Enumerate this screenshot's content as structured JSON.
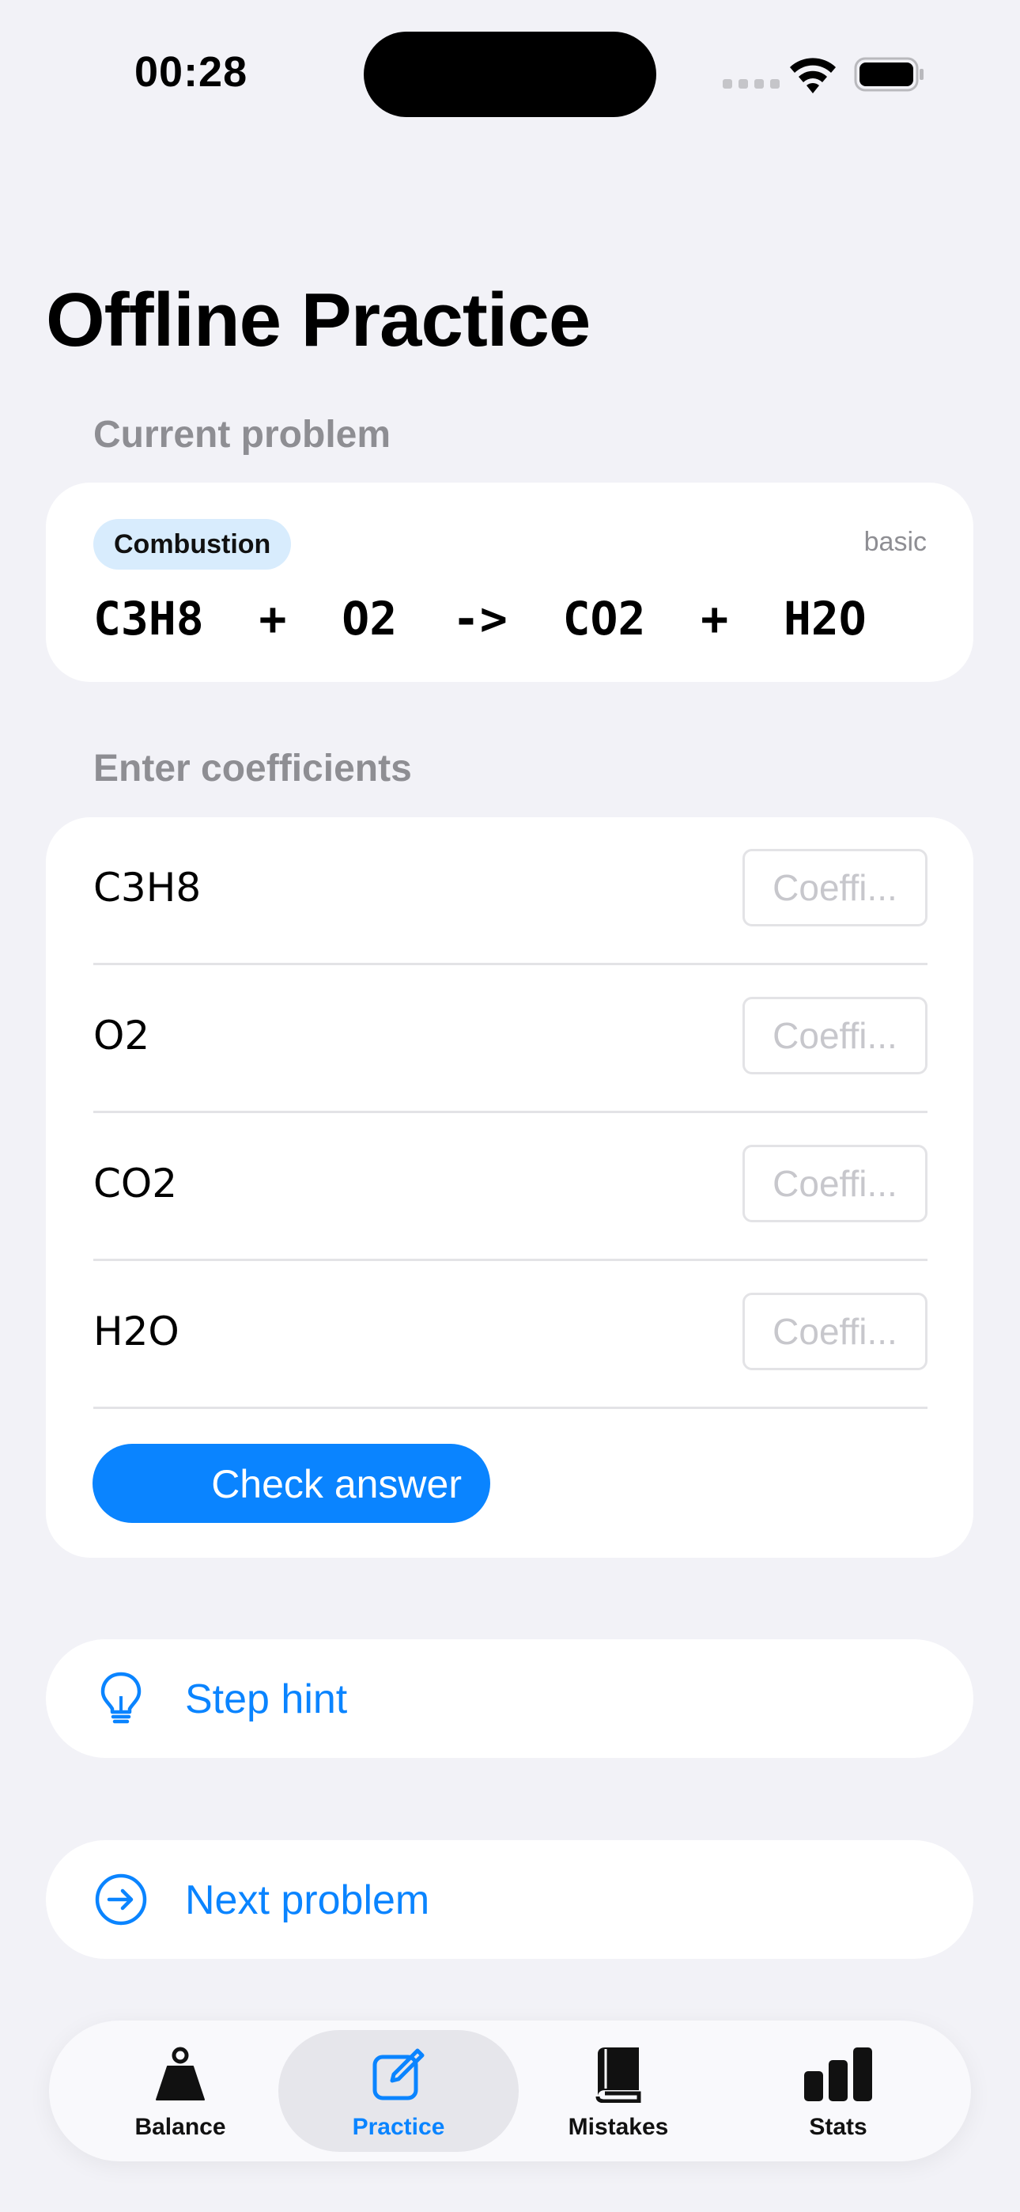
{
  "status_bar": {
    "time": "00:28"
  },
  "page_title": "Offline Practice",
  "current_problem": {
    "header": "Current problem",
    "category": "Combustion",
    "level": "basic",
    "equation": "C3H8 + O2 -> CO2 + H2O"
  },
  "coefficients": {
    "header": "Enter coefficients",
    "rows": [
      {
        "species": "C3H8",
        "placeholder": "Coeffi...",
        "value": ""
      },
      {
        "species": "O2",
        "placeholder": "Coeffi...",
        "value": ""
      },
      {
        "species": "CO2",
        "placeholder": "Coeffi...",
        "value": ""
      },
      {
        "species": "H2O",
        "placeholder": "Coeffi...",
        "value": ""
      }
    ],
    "check_label": "Check answer"
  },
  "actions": {
    "hint_label": "Step hint",
    "next_label": "Next problem"
  },
  "tabs": [
    {
      "label": "Balance",
      "icon": "scale-weight-icon",
      "active": false
    },
    {
      "label": "Practice",
      "icon": "square-pencil-icon",
      "active": true
    },
    {
      "label": "Mistakes",
      "icon": "book-icon",
      "active": false
    },
    {
      "label": "Stats",
      "icon": "bar-chart-icon",
      "active": false
    }
  ],
  "colors": {
    "accent": "#0a84ff",
    "background": "#f2f2f7",
    "chip": "#d8ecfd"
  }
}
